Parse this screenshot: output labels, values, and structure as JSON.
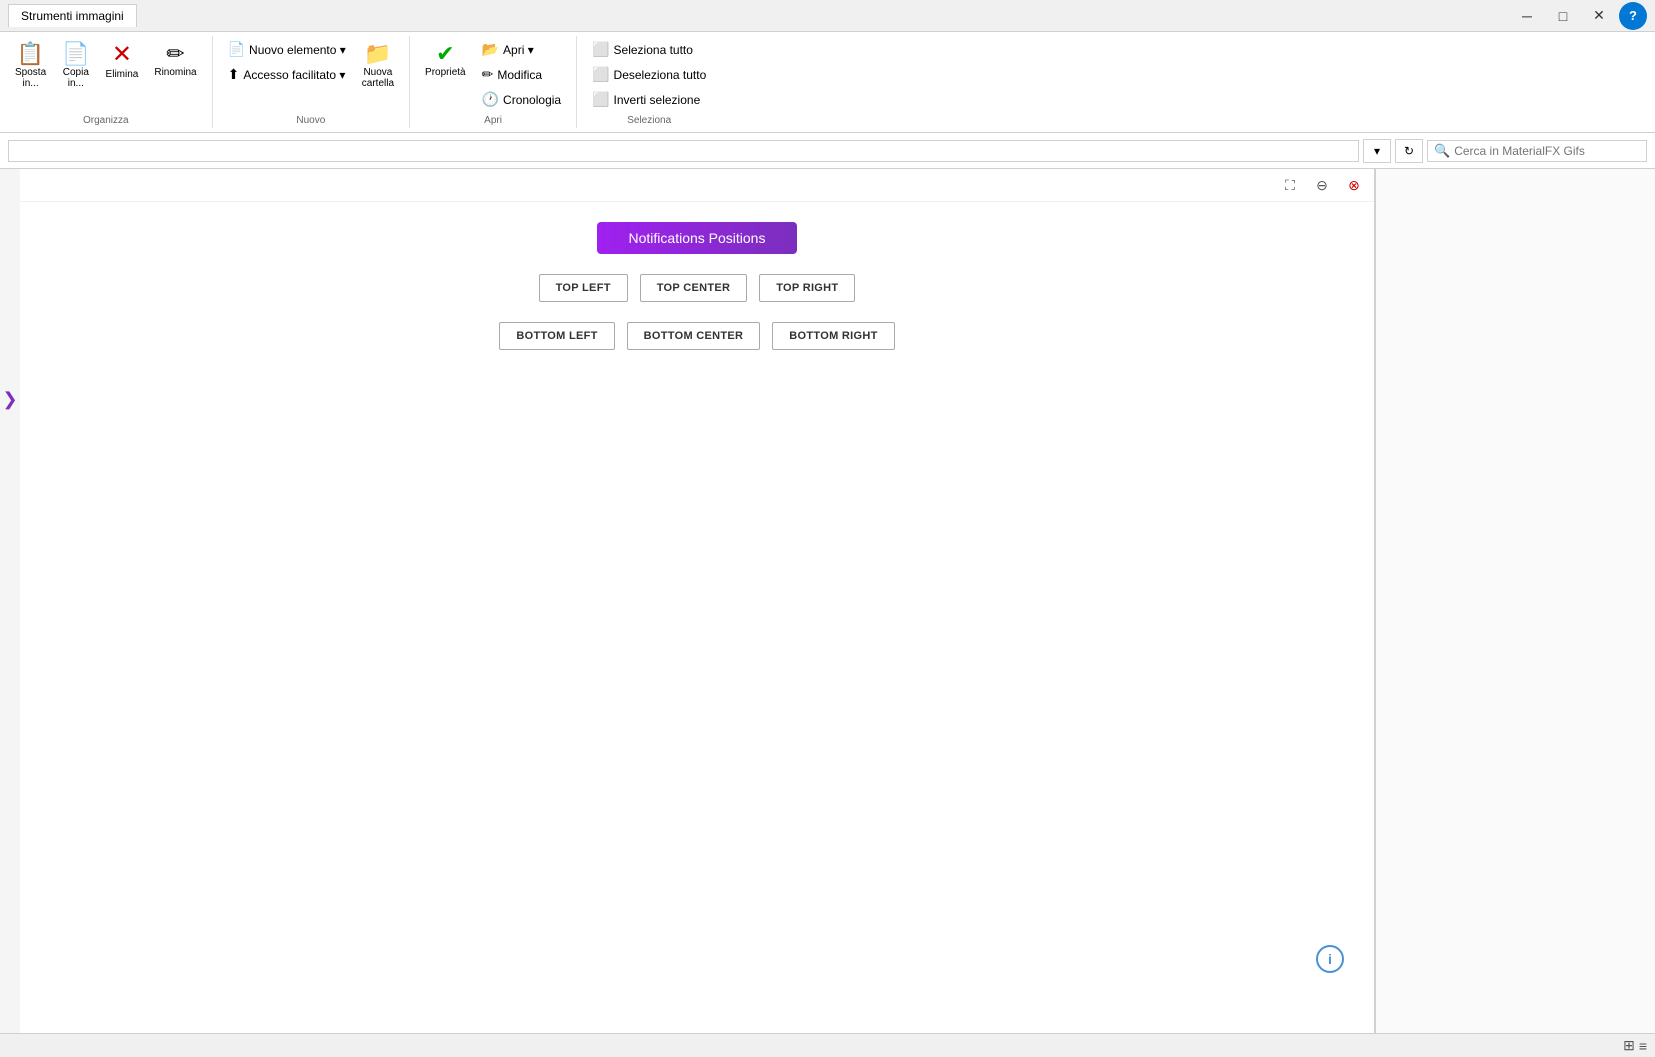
{
  "titlebar": {
    "tab_label": "Strumenti immagini",
    "minimize": "─",
    "maximize": "□",
    "close": "✕",
    "help": "?"
  },
  "ribbon": {
    "groups": [
      {
        "name": "organizza",
        "label": "Organizza",
        "items": [
          {
            "id": "sposta",
            "icon": "📋",
            "label": "Sposta\nin..."
          },
          {
            "id": "copia",
            "icon": "📄",
            "label": "Copia\nin..."
          },
          {
            "id": "elimina",
            "icon": "✗",
            "label": "Elimina"
          },
          {
            "id": "rinomina",
            "icon": "✏",
            "label": "Rinomina"
          }
        ]
      },
      {
        "name": "nuovo",
        "label": "Nuovo",
        "items": [
          {
            "id": "nuovo-elemento",
            "icon": "📄",
            "label": "Nuovo elemento ▾"
          },
          {
            "id": "accesso-facilitato",
            "icon": "⬆",
            "label": "Accesso facilitato ▾"
          },
          {
            "id": "nuova-cartella",
            "icon": "📁",
            "label": "Nuova\ncartella"
          }
        ]
      },
      {
        "name": "apri",
        "label": "Apri",
        "items": [
          {
            "id": "proprieta",
            "icon": "✔",
            "label": "Proprietà"
          },
          {
            "id": "apri",
            "icon": "📂",
            "label": "Apri ▾"
          },
          {
            "id": "modifica",
            "icon": "✏",
            "label": "Modifica"
          },
          {
            "id": "cronologia",
            "icon": "🕐",
            "label": "Cronologia"
          }
        ]
      },
      {
        "name": "seleziona",
        "label": "Seleziona",
        "items": [
          {
            "id": "seleziona-tutto",
            "icon": "⬜",
            "label": "Seleziona tutto"
          },
          {
            "id": "deseleziona-tutto",
            "icon": "⬜",
            "label": "Deseleziona tutto"
          },
          {
            "id": "inverti-selezione",
            "icon": "⬜",
            "label": "Inverti selezione"
          }
        ]
      }
    ]
  },
  "addressbar": {
    "dropdown_arrow": "▾",
    "refresh": "↻",
    "search_placeholder": "Cerca in MaterialFX Gifs",
    "search_icon": "🔍"
  },
  "preview": {
    "toolbar_icons": [
      "⛶",
      "⊖",
      "⊗"
    ],
    "notifications_title": "Notifications Positions",
    "position_buttons": [
      {
        "id": "top-left",
        "label": "TOP LEFT"
      },
      {
        "id": "top-center",
        "label": "TOP CENTER"
      },
      {
        "id": "top-right",
        "label": "TOP RIGHT"
      },
      {
        "id": "bottom-left",
        "label": "BOTTOM LEFT"
      },
      {
        "id": "bottom-center",
        "label": "BOTTOM CENTER"
      },
      {
        "id": "bottom-right",
        "label": "BOTTOM RIGHT"
      }
    ],
    "info_icon": "ℹ",
    "expand_arrow": "❯"
  },
  "statusbar": {
    "icons": [
      "⊞",
      "≡"
    ]
  }
}
